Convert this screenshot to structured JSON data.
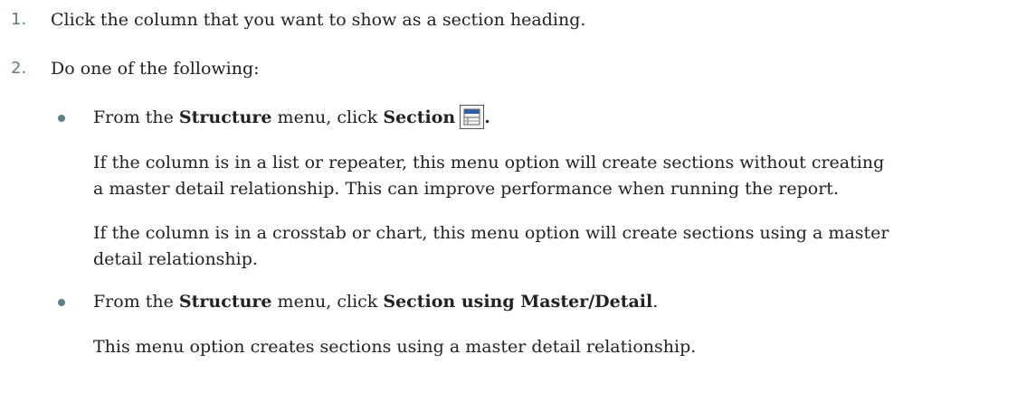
{
  "steps": [
    {
      "number": "1.",
      "text": "Click the column that you want to show as a section heading."
    },
    {
      "number": "2.",
      "text": "Do one of the following:"
    }
  ],
  "options": [
    {
      "prefix": "From the ",
      "menu": "Structure",
      "middle": " menu, click ",
      "command": "Section",
      "icon": "section-icon",
      "suffix": ".",
      "paragraphs": [
        [
          "If the column is in a list or repeater, this menu option will create sections without creating",
          "a master detail relationship. This can improve performance when running the report."
        ],
        [
          "If the column is in a crosstab or chart, this menu option will create sections using a master",
          "detail relationship."
        ]
      ]
    },
    {
      "prefix": "From the ",
      "menu": "Structure",
      "middle": " menu, click ",
      "command": "Section using Master/Detail",
      "suffix": ".",
      "paragraphs": [
        [
          "This menu option creates sections using a master detail relationship."
        ]
      ]
    }
  ],
  "colors": {
    "step_number": "#5e7b85",
    "bullet": "#5f7f88",
    "text": "#222222",
    "icon_blue": "#2c5fa8"
  }
}
